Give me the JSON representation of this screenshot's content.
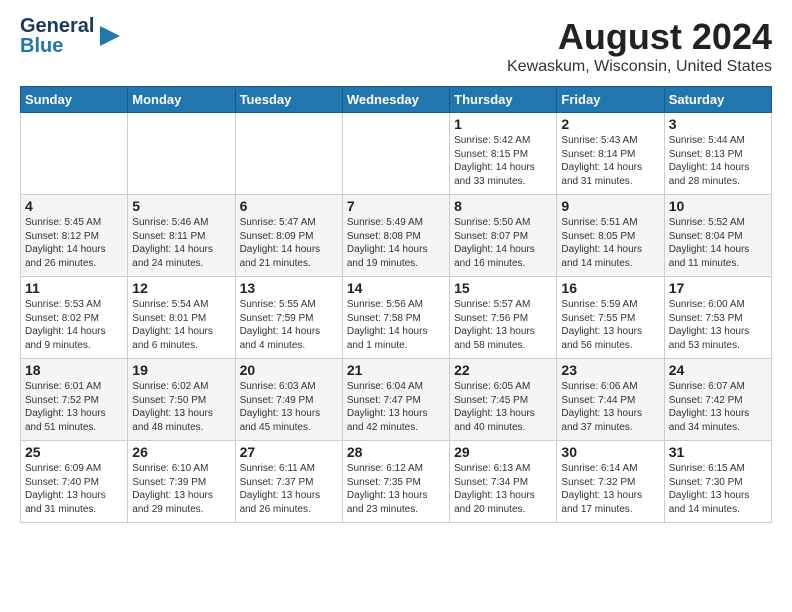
{
  "header": {
    "logo_line1": "General",
    "logo_line2": "Blue",
    "title": "August 2024",
    "subtitle": "Kewaskum, Wisconsin, United States"
  },
  "days_of_week": [
    "Sunday",
    "Monday",
    "Tuesday",
    "Wednesday",
    "Thursday",
    "Friday",
    "Saturday"
  ],
  "weeks": [
    [
      {
        "day": "",
        "detail": ""
      },
      {
        "day": "",
        "detail": ""
      },
      {
        "day": "",
        "detail": ""
      },
      {
        "day": "",
        "detail": ""
      },
      {
        "day": "1",
        "detail": "Sunrise: 5:42 AM\nSunset: 8:15 PM\nDaylight: 14 hours\nand 33 minutes."
      },
      {
        "day": "2",
        "detail": "Sunrise: 5:43 AM\nSunset: 8:14 PM\nDaylight: 14 hours\nand 31 minutes."
      },
      {
        "day": "3",
        "detail": "Sunrise: 5:44 AM\nSunset: 8:13 PM\nDaylight: 14 hours\nand 28 minutes."
      }
    ],
    [
      {
        "day": "4",
        "detail": "Sunrise: 5:45 AM\nSunset: 8:12 PM\nDaylight: 14 hours\nand 26 minutes."
      },
      {
        "day": "5",
        "detail": "Sunrise: 5:46 AM\nSunset: 8:11 PM\nDaylight: 14 hours\nand 24 minutes."
      },
      {
        "day": "6",
        "detail": "Sunrise: 5:47 AM\nSunset: 8:09 PM\nDaylight: 14 hours\nand 21 minutes."
      },
      {
        "day": "7",
        "detail": "Sunrise: 5:49 AM\nSunset: 8:08 PM\nDaylight: 14 hours\nand 19 minutes."
      },
      {
        "day": "8",
        "detail": "Sunrise: 5:50 AM\nSunset: 8:07 PM\nDaylight: 14 hours\nand 16 minutes."
      },
      {
        "day": "9",
        "detail": "Sunrise: 5:51 AM\nSunset: 8:05 PM\nDaylight: 14 hours\nand 14 minutes."
      },
      {
        "day": "10",
        "detail": "Sunrise: 5:52 AM\nSunset: 8:04 PM\nDaylight: 14 hours\nand 11 minutes."
      }
    ],
    [
      {
        "day": "11",
        "detail": "Sunrise: 5:53 AM\nSunset: 8:02 PM\nDaylight: 14 hours\nand 9 minutes."
      },
      {
        "day": "12",
        "detail": "Sunrise: 5:54 AM\nSunset: 8:01 PM\nDaylight: 14 hours\nand 6 minutes."
      },
      {
        "day": "13",
        "detail": "Sunrise: 5:55 AM\nSunset: 7:59 PM\nDaylight: 14 hours\nand 4 minutes."
      },
      {
        "day": "14",
        "detail": "Sunrise: 5:56 AM\nSunset: 7:58 PM\nDaylight: 14 hours\nand 1 minute."
      },
      {
        "day": "15",
        "detail": "Sunrise: 5:57 AM\nSunset: 7:56 PM\nDaylight: 13 hours\nand 58 minutes."
      },
      {
        "day": "16",
        "detail": "Sunrise: 5:59 AM\nSunset: 7:55 PM\nDaylight: 13 hours\nand 56 minutes."
      },
      {
        "day": "17",
        "detail": "Sunrise: 6:00 AM\nSunset: 7:53 PM\nDaylight: 13 hours\nand 53 minutes."
      }
    ],
    [
      {
        "day": "18",
        "detail": "Sunrise: 6:01 AM\nSunset: 7:52 PM\nDaylight: 13 hours\nand 51 minutes."
      },
      {
        "day": "19",
        "detail": "Sunrise: 6:02 AM\nSunset: 7:50 PM\nDaylight: 13 hours\nand 48 minutes."
      },
      {
        "day": "20",
        "detail": "Sunrise: 6:03 AM\nSunset: 7:49 PM\nDaylight: 13 hours\nand 45 minutes."
      },
      {
        "day": "21",
        "detail": "Sunrise: 6:04 AM\nSunset: 7:47 PM\nDaylight: 13 hours\nand 42 minutes."
      },
      {
        "day": "22",
        "detail": "Sunrise: 6:05 AM\nSunset: 7:45 PM\nDaylight: 13 hours\nand 40 minutes."
      },
      {
        "day": "23",
        "detail": "Sunrise: 6:06 AM\nSunset: 7:44 PM\nDaylight: 13 hours\nand 37 minutes."
      },
      {
        "day": "24",
        "detail": "Sunrise: 6:07 AM\nSunset: 7:42 PM\nDaylight: 13 hours\nand 34 minutes."
      }
    ],
    [
      {
        "day": "25",
        "detail": "Sunrise: 6:09 AM\nSunset: 7:40 PM\nDaylight: 13 hours\nand 31 minutes."
      },
      {
        "day": "26",
        "detail": "Sunrise: 6:10 AM\nSunset: 7:39 PM\nDaylight: 13 hours\nand 29 minutes."
      },
      {
        "day": "27",
        "detail": "Sunrise: 6:11 AM\nSunset: 7:37 PM\nDaylight: 13 hours\nand 26 minutes."
      },
      {
        "day": "28",
        "detail": "Sunrise: 6:12 AM\nSunset: 7:35 PM\nDaylight: 13 hours\nand 23 minutes."
      },
      {
        "day": "29",
        "detail": "Sunrise: 6:13 AM\nSunset: 7:34 PM\nDaylight: 13 hours\nand 20 minutes."
      },
      {
        "day": "30",
        "detail": "Sunrise: 6:14 AM\nSunset: 7:32 PM\nDaylight: 13 hours\nand 17 minutes."
      },
      {
        "day": "31",
        "detail": "Sunrise: 6:15 AM\nSunset: 7:30 PM\nDaylight: 13 hours\nand 14 minutes."
      }
    ]
  ]
}
